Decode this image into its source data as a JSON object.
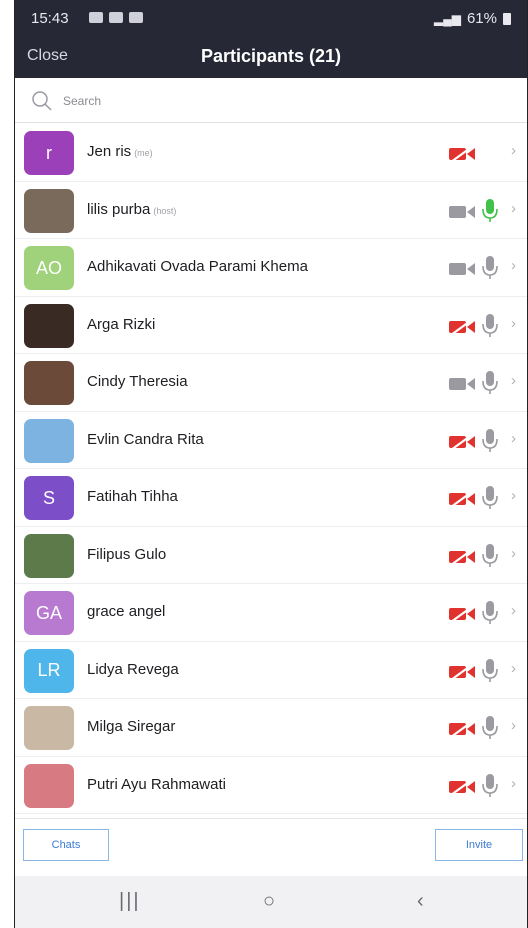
{
  "status_bar": {
    "time": "15:43",
    "battery": "61%"
  },
  "header": {
    "close_label": "Close",
    "title": "Participants (21)"
  },
  "search": {
    "placeholder": "Search"
  },
  "participants": [
    {
      "name": "Jen ris",
      "tag": "(me)",
      "avatar_text": "r",
      "avatar_color": "#9b40b8",
      "video_off": true,
      "mic": "none"
    },
    {
      "name": "lilis purba",
      "tag": "(host)",
      "avatar_text": "",
      "avatar_color": "#7a6a5c",
      "video_off": false,
      "mic": "active"
    },
    {
      "name": "Adhikavati Ovada Parami Khema",
      "tag": "",
      "avatar_text": "AO",
      "avatar_color": "#9fd27a",
      "video_off": false,
      "mic": "muted"
    },
    {
      "name": "Arga Rizki",
      "tag": "",
      "avatar_text": "",
      "avatar_color": "#3a2a24",
      "video_off": true,
      "mic": "muted"
    },
    {
      "name": "Cindy Theresia",
      "tag": "",
      "avatar_text": "",
      "avatar_color": "#6b4a3a",
      "video_off": false,
      "mic": "muted"
    },
    {
      "name": "Evlin Candra Rita",
      "tag": "",
      "avatar_text": "",
      "avatar_color": "#7cb3e0",
      "video_off": true,
      "mic": "muted"
    },
    {
      "name": "Fatihah Tihha",
      "tag": "",
      "avatar_text": "S",
      "avatar_color": "#7c4fc9",
      "video_off": true,
      "mic": "muted"
    },
    {
      "name": "Filipus Gulo",
      "tag": "",
      "avatar_text": "",
      "avatar_color": "#5c7a4a",
      "video_off": true,
      "mic": "muted"
    },
    {
      "name": "grace angel",
      "tag": "",
      "avatar_text": "GA",
      "avatar_color": "#b77ad0",
      "video_off": true,
      "mic": "muted"
    },
    {
      "name": "Lidya Revega",
      "tag": "",
      "avatar_text": "LR",
      "avatar_color": "#4fb6ec",
      "video_off": true,
      "mic": "muted"
    },
    {
      "name": "Milga Siregar",
      "tag": "",
      "avatar_text": "",
      "avatar_color": "#c9b8a4",
      "video_off": true,
      "mic": "muted"
    },
    {
      "name": "Putri Ayu Rahmawati",
      "tag": "",
      "avatar_text": "",
      "avatar_color": "#d77a82",
      "video_off": true,
      "mic": "muted"
    }
  ],
  "footer": {
    "chats_label": "Chats",
    "invite_label": "Invite"
  },
  "colors": {
    "accent": "#3a7bd5",
    "video_off": "#e0322e",
    "mic_active": "#42c24a",
    "icon_gray": "#9a9aa0",
    "header_bg": "#262836"
  }
}
